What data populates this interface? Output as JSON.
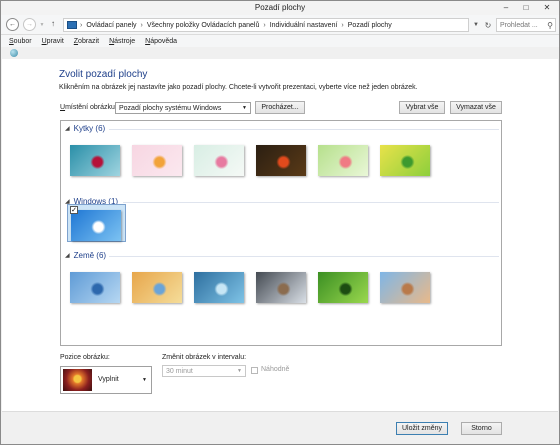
{
  "window": {
    "title": "Pozadí plochy",
    "minimize_icon": "minimize-icon",
    "maximize_icon": "maximize-icon",
    "close_icon": "close-icon"
  },
  "address": {
    "breadcrumb": [
      "Ovládací panely",
      "Všechny položky Ovládacích panelů",
      "Individuální nastavení",
      "Pozadí plochy"
    ],
    "search_placeholder": "Prohledat ..."
  },
  "menu": [
    {
      "label": "Soubor",
      "accel_index": 0
    },
    {
      "label": "Upravit",
      "accel_index": 0
    },
    {
      "label": "Zobrazit",
      "accel_index": 0
    },
    {
      "label": "Nástroje",
      "accel_index": 0
    },
    {
      "label": "Nápověda",
      "accel_index": 0
    }
  ],
  "main": {
    "heading": "Zvolit pozadí plochy",
    "description": "Klikněním na obrázek jej nastavíte jako pozadí plochy. Chcete-li vytvořit prezentaci, vyberte více než jeden obrázek.",
    "location_label": "Umístění obrázku:",
    "location_value": "Pozadí plochy systému Windows",
    "browse_button": "Procházet...",
    "select_all_button": "Vybrat vše",
    "clear_all_button": "Vymazat vše"
  },
  "groups": [
    {
      "label": "Kytky (6)",
      "thumbs": [
        {
          "colors": [
            "#2a8fa8",
            "#9fd4e0",
            "#b5123a"
          ],
          "selected": false
        },
        {
          "colors": [
            "#f7d6e2",
            "#fbe8ef",
            "#f2a33a"
          ],
          "selected": false
        },
        {
          "colors": [
            "#d8eee4",
            "#f5f9f6",
            "#e77aa0"
          ],
          "selected": false
        },
        {
          "colors": [
            "#2b1f12",
            "#5a3a17",
            "#e24a1c"
          ],
          "selected": false
        },
        {
          "colors": [
            "#b6e08c",
            "#e9f7d7",
            "#f07a84"
          ],
          "selected": false
        },
        {
          "colors": [
            "#e8e24a",
            "#8dcf3c",
            "#3d9a2f"
          ],
          "selected": false
        }
      ]
    },
    {
      "label": "Windows (1)",
      "thumbs": [
        {
          "colors": [
            "#1f77d4",
            "#7cc2f2",
            "#ffffff"
          ],
          "selected": true
        }
      ]
    },
    {
      "label": "Země (6)",
      "thumbs": [
        {
          "colors": [
            "#5f9bd6",
            "#b6d7f2",
            "#2d68ad"
          ],
          "selected": false
        },
        {
          "colors": [
            "#e7a64b",
            "#f5dd9a",
            "#6aa4d8"
          ],
          "selected": false
        },
        {
          "colors": [
            "#2e6f9f",
            "#7fc3e6",
            "#c7e6f5"
          ],
          "selected": false
        },
        {
          "colors": [
            "#444a52",
            "#d9dfe6",
            "#8b6c4f"
          ],
          "selected": false
        },
        {
          "colors": [
            "#3b8f23",
            "#9ad84e",
            "#1c4d12"
          ],
          "selected": false
        },
        {
          "colors": [
            "#7fb6e6",
            "#e8b98a",
            "#b97a4a"
          ],
          "selected": false
        }
      ]
    }
  ],
  "bottom": {
    "position_label": "Pozice obrázku:",
    "position_value": "Vyplnit",
    "interval_label": "Změnit obrázek v intervalu:",
    "interval_value": "30 minut",
    "shuffle_label": "Náhodně"
  },
  "footer": {
    "save_button": "Uložit změny",
    "cancel_button": "Storno"
  },
  "colors": {
    "accent": "#1e3f8a",
    "selection": "#cce4f7"
  }
}
